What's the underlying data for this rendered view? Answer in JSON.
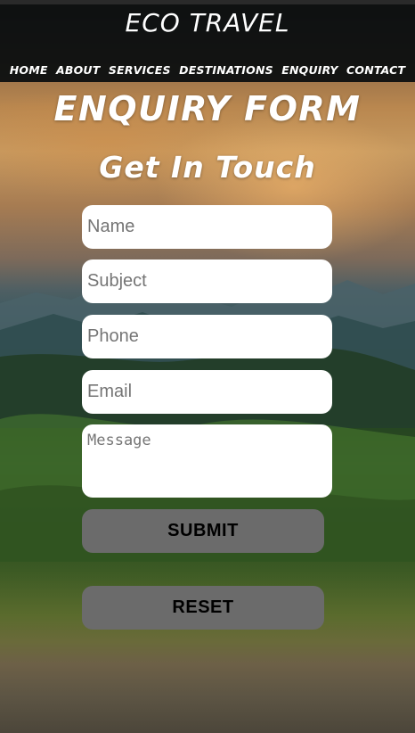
{
  "header": {
    "title": "ECO TRAVEL",
    "nav": [
      "HOME",
      "ABOUT",
      "SERVICES",
      "DESTINATIONS",
      "ENQUIRY",
      "CONTACT"
    ]
  },
  "main": {
    "heading": "ENQUIRY FORM",
    "subheading": "Get In Touch",
    "form": {
      "name_placeholder": "Name",
      "subject_placeholder": "Subject",
      "phone_placeholder": "Phone",
      "email_placeholder": "Email",
      "message_placeholder": "Message",
      "submit_label": "SUBMIT",
      "reset_label": "RESET"
    }
  },
  "colors": {
    "header_bg": "#080c0e",
    "button_bg": "#6b6b6b",
    "field_bg": "#ffffff",
    "text_light": "#ffffff"
  }
}
